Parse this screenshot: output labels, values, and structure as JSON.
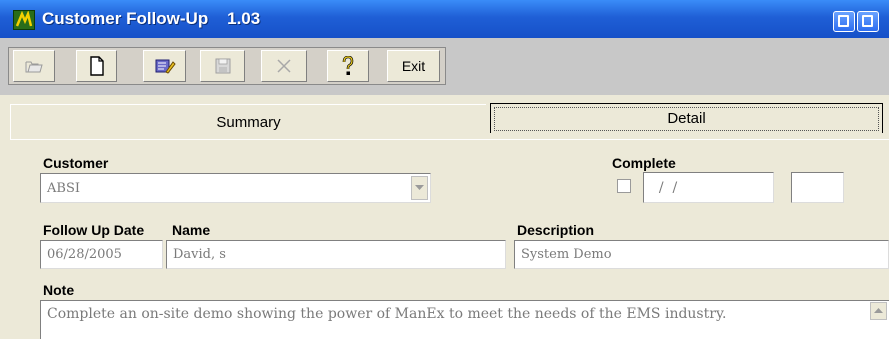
{
  "window": {
    "title": "Customer Follow-Up",
    "version": "1.03",
    "icons": [
      "app-icon",
      "minimize-icon",
      "maximize-icon"
    ]
  },
  "toolbar": {
    "buttons": [
      {
        "name": "open-folder-icon",
        "enabled": false
      },
      {
        "name": "new-document-icon",
        "enabled": true
      },
      {
        "name": "edit-icon",
        "enabled": true
      },
      {
        "name": "save-icon",
        "enabled": false
      },
      {
        "name": "delete-icon",
        "enabled": false
      },
      {
        "name": "help-icon",
        "enabled": true
      }
    ],
    "exit_label": "Exit"
  },
  "tabs": {
    "summary": "Summary",
    "detail": "Detail",
    "active": "Detail"
  },
  "form": {
    "customer_label": "Customer",
    "customer_value": "ABSI",
    "complete_label": "Complete",
    "complete_checked": false,
    "complete_date": "  /  /",
    "complete_extra": "",
    "followup_date_label": "Follow Up Date",
    "followup_date_value": "06/28/2005",
    "name_label": "Name",
    "name_value": "David, s",
    "description_label": "Description",
    "description_value": "System Demo",
    "note_label": "Note",
    "note_value": "Complete an on-site demo showing the power of ManEx to meet the needs of the EMS industry."
  },
  "colors": {
    "titlebar": "#1f5fd6",
    "dialog_bg": "#ece9d8",
    "toolbar_bg": "#c8c8c8",
    "field_text": "#7a7a7a"
  }
}
